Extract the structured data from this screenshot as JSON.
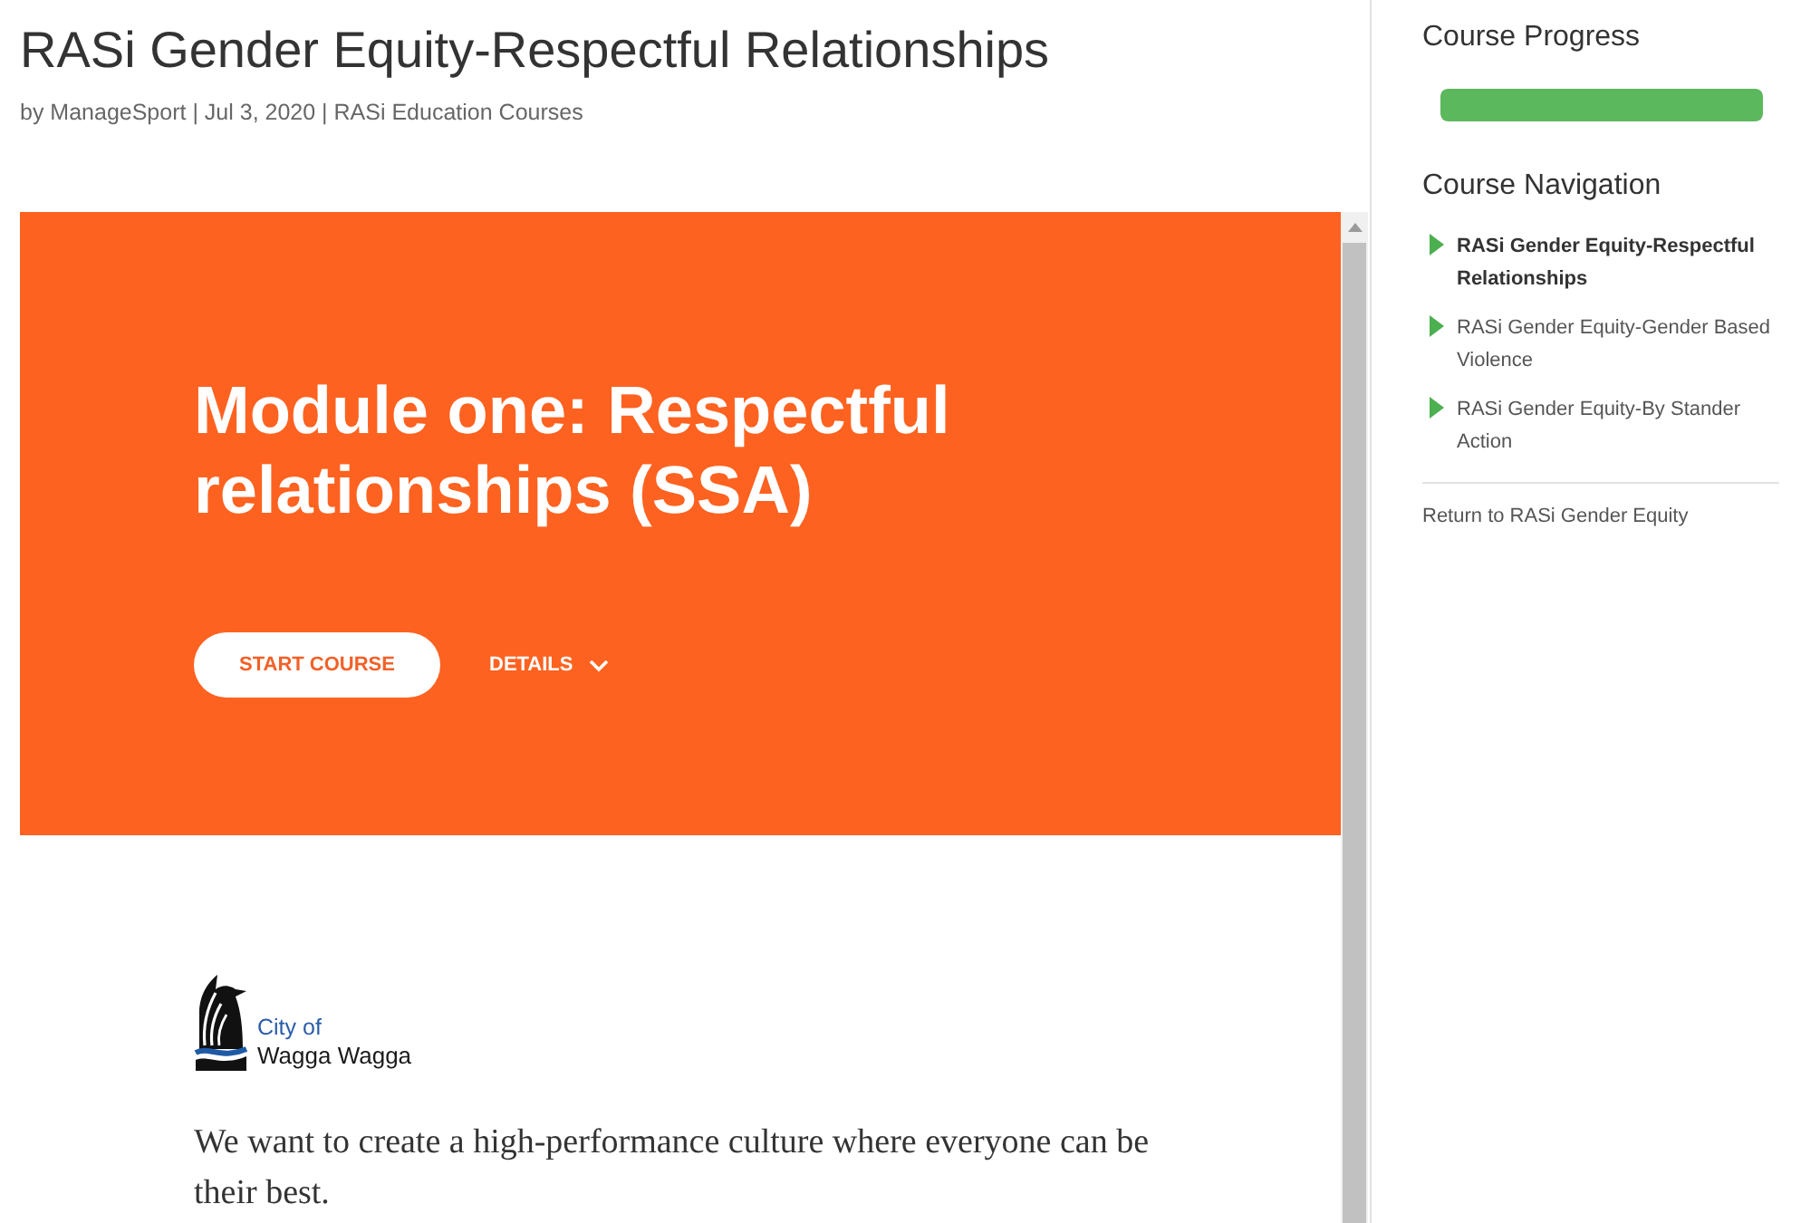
{
  "page": {
    "title": "RASi Gender Equity-Respectful Relationships",
    "meta": "by ManageSport | Jul 3, 2020 | RASi Education Courses"
  },
  "course_frame": {
    "hero": {
      "heading": "Module one: Respectful relationships (SSA)",
      "start_button": "START COURSE",
      "details_button": "DETAILS"
    },
    "logo": {
      "line_1": "City of",
      "line_2": "Wagga Wagga"
    },
    "paragraph": "We want to create a high-performance culture where everyone can be their best."
  },
  "sidebar": {
    "progress": {
      "title": "Course Progress",
      "level": 1
    },
    "navigation": {
      "title": "Course Navigation",
      "items": [
        {
          "label": "RASi Gender Equity-Respectful Relationships",
          "selected": true
        },
        {
          "label": "RASi Gender Equity-Gender Based Violence",
          "selected": false
        },
        {
          "label": "RASi Gender Equity-By Stander Action",
          "selected": false
        }
      ],
      "return_link": "Return to RASi Gender Equity"
    }
  }
}
